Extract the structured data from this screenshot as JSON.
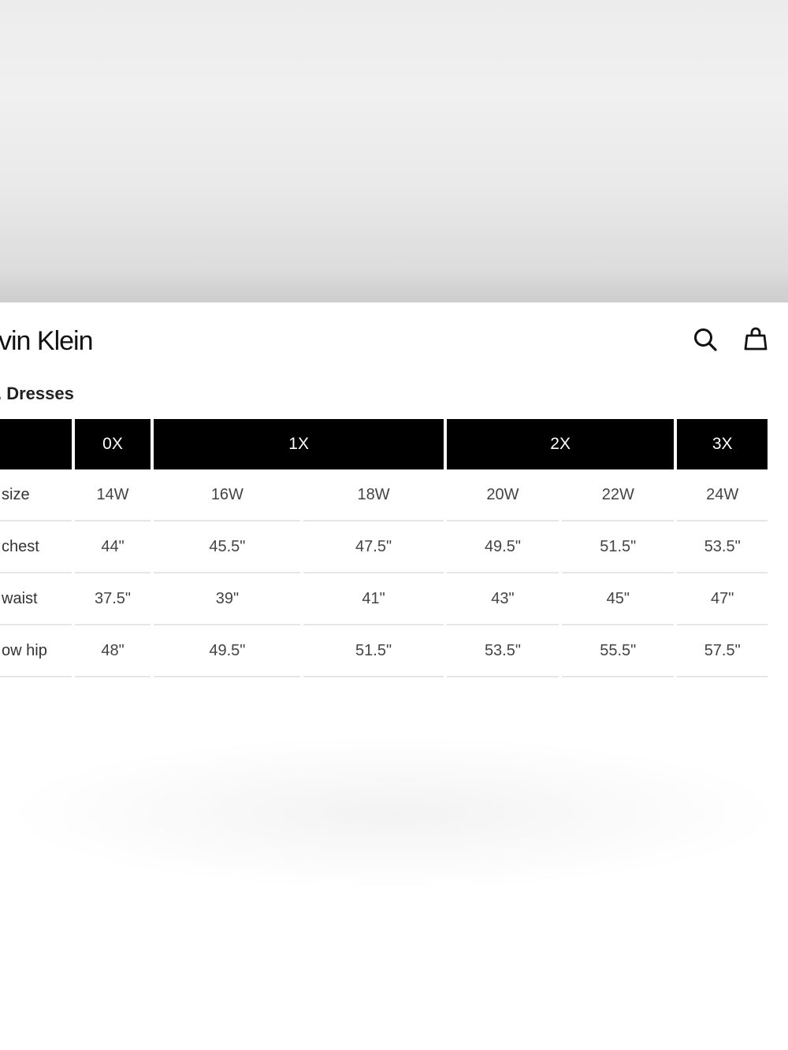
{
  "header": {
    "brand": "vin Klein"
  },
  "icons": {
    "search": "search-icon",
    "bag": "shopping-bag-icon"
  },
  "category": {
    "title": ". Dresses"
  },
  "size_chart": {
    "groups": [
      {
        "label": "",
        "span": 1
      },
      {
        "label": "0X",
        "span": 1
      },
      {
        "label": "1X",
        "span": 2
      },
      {
        "label": "2X",
        "span": 2
      },
      {
        "label": "3X",
        "span": 1
      }
    ],
    "rows": [
      {
        "label": "size",
        "values": [
          "14W",
          "16W",
          "18W",
          "20W",
          "22W",
          "24W"
        ]
      },
      {
        "label": "chest",
        "values": [
          "44\"",
          "45.5\"",
          "47.5\"",
          "49.5\"",
          "51.5\"",
          "53.5\""
        ]
      },
      {
        "label": "waist",
        "values": [
          "37.5\"",
          "39\"",
          "41\"",
          "43\"",
          "45\"",
          "47\""
        ]
      },
      {
        "label": "ow hip",
        "values": [
          "48\"",
          "49.5\"",
          "51.5\"",
          "53.5\"",
          "55.5\"",
          "57.5\""
        ]
      }
    ]
  }
}
